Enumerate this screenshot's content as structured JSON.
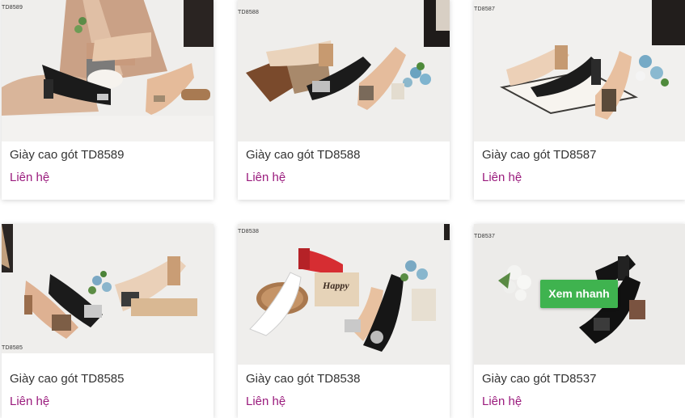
{
  "products": [
    {
      "code": "TD8589",
      "name": "Giày cao gót TD8589",
      "price": "Liên hệ"
    },
    {
      "code": "TD8588",
      "name": "Giày cao gót TD8588",
      "price": "Liên hệ"
    },
    {
      "code": "TD8587",
      "name": "Giày cao gót TD8587",
      "price": "Liên hệ"
    },
    {
      "code": "TD8585",
      "name": "Giày cao gót TD8585",
      "price": "Liên hệ"
    },
    {
      "code": "TD8538",
      "name": "Giày cao gót TD8538",
      "price": "Liên hệ"
    },
    {
      "code": "TD8537",
      "name": "Giày cao gót TD8537",
      "price": "Liên hệ"
    }
  ],
  "quick_view_label": "Xem nhanh",
  "box_text": "Happy",
  "colors": {
    "price": "#9a1b7d",
    "quick_view_button": "#3fb34f"
  }
}
